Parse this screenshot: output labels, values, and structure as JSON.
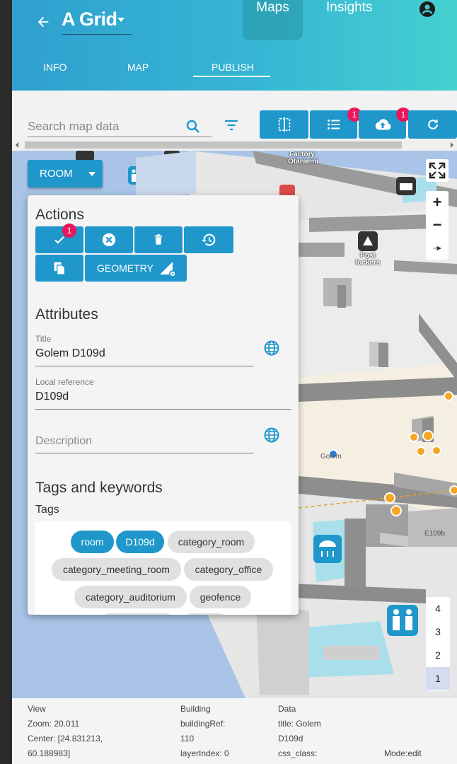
{
  "header": {
    "title": "A Grid",
    "nav": {
      "maps": "Maps",
      "insights": "Insights"
    },
    "tabs": [
      "INFO",
      "MAP",
      "PUBLISH"
    ],
    "active_tab": "PUBLISH"
  },
  "toolbar": {
    "search_placeholder": "Search map data",
    "list_badge": "1",
    "upload_badge": "1"
  },
  "map": {
    "room_button": "ROOM",
    "labels": {
      "factory": "Factory\nOtaniemi",
      "post": "Post\nlockers",
      "golem": "Golem",
      "room_e109b": "E109b"
    },
    "floors": [
      "4",
      "3",
      "2",
      "1"
    ],
    "active_floor": "1",
    "zoom_in": "+",
    "zoom_out": "−"
  },
  "panel": {
    "actions_title": "Actions",
    "approve_badge": "1",
    "geometry_label": "GEOMETRY",
    "attributes_title": "Attributes",
    "title_label": "Title",
    "title_value": "Golem D109d",
    "local_ref_label": "Local reference",
    "local_ref_value": "D109d",
    "description_placeholder": "Description",
    "tags_title": "Tags and keywords",
    "tags_label": "Tags",
    "tags": [
      {
        "label": "room",
        "selected": true
      },
      {
        "label": "D109d",
        "selected": true
      },
      {
        "label": "category_room",
        "selected": false
      },
      {
        "label": "category_meeting_room",
        "selected": false
      },
      {
        "label": "category_office",
        "selected": false
      },
      {
        "label": "category_auditorium",
        "selected": false
      },
      {
        "label": "geofence",
        "selected": false
      }
    ]
  },
  "status": {
    "view": {
      "title": "View",
      "zoom": "Zoom: 20.011",
      "center1": "Center: [24.831213,",
      "center2": "60.188983]"
    },
    "building": {
      "title": "Building",
      "ref1": "buildingRef:",
      "ref2": "110",
      "layer": "layerIndex: 0"
    },
    "data": {
      "title": "Data",
      "t1": "title: Golem",
      "t2": "D109d",
      "css": "css_class:"
    },
    "mode": "Mode:edit"
  },
  "colors": {
    "primary": "#1f97cb",
    "badge": "#e8175d",
    "header_start": "#2fa0cf",
    "header_end": "#45d0d0"
  }
}
